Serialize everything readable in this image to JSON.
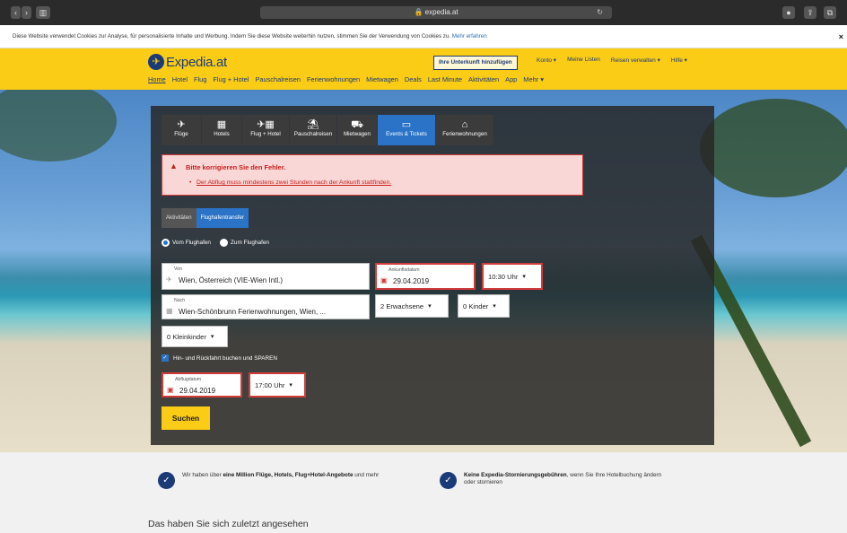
{
  "browser": {
    "url": "expedia.at"
  },
  "cookie": {
    "text": "Diese Website verwendet Cookies zur Analyse, für personalisierte Inhalte und Werbung. Indem Sie diese Website weiterhin nutzen, stimmen Sie der Verwendung von Cookies zu.",
    "link": "Mehr erfahren"
  },
  "header": {
    "brand": "Expedia.at",
    "add_property": "Ihre Unterkunft hinzufügen",
    "account_links": [
      "Konto ▾",
      "Meine Listen",
      "Reisen verwalten ▾",
      "Hilfe ▾"
    ],
    "nav": [
      "Home",
      "Hotel",
      "Flug",
      "Flug + Hotel",
      "Pauschalreisen",
      "Ferienwohnungen",
      "Mietwagen",
      "Deals",
      "Last Minute",
      "Aktivitäten",
      "App",
      "Mehr ▾"
    ]
  },
  "search": {
    "tabs": [
      {
        "label": "Flüge",
        "icon": "plane-icon"
      },
      {
        "label": "Hotels",
        "icon": "hotel-icon"
      },
      {
        "label": "Flug + Hotel",
        "icon": "flight-hotel-icon"
      },
      {
        "label": "Pauschalreisen",
        "icon": "palm-icon"
      },
      {
        "label": "Mietwagen",
        "icon": "car-icon"
      },
      {
        "label": "Events & Tickets",
        "icon": "ticket-icon"
      },
      {
        "label": "Ferienwohnungen",
        "icon": "house-icon"
      }
    ],
    "active_tab": "Events & Tickets",
    "error_title": "Bitte korrigieren Sie den Fehler.",
    "error_message": "Der Abflug muss mindestens zwei Stunden nach der Ankunft stattfinden.",
    "subtabs": [
      "Aktivitäten",
      "Flughafentransfer"
    ],
    "radios": [
      "Vom Flughafen",
      "Zum Flughafen"
    ],
    "from_label": "Von",
    "from_value": "Wien, Österreich (VIE-Wien Intl.)",
    "arrival_label": "Ankunftsdatum",
    "arrival_value": "29.04.2019",
    "arrival_time": "10:30 Uhr",
    "to_label": "Nach",
    "to_value": "Wien-Schönbrunn Ferienwohnungen, Wien, ...",
    "adults": "2 Erwachsene",
    "children": "0 Kinder",
    "infants": "0 Kleinkinder",
    "roundtrip": "Hin- und Rückfahrt buchen und SPAREN",
    "departure_label": "Abflugdatum",
    "departure_value": "29.04.2019",
    "departure_time": "17:00 Uhr",
    "submit": "Suchen"
  },
  "features": {
    "f1_pre": "Wir haben über ",
    "f1_bold": "eine Million Flüge, Hotels, Flug+Hotel-Angebote",
    "f1_post": " und mehr",
    "f2_bold": "Keine Expedia-Stornierungsgebühren",
    "f2_post": ", wenn Sie Ihre Hotelbuchung ändern oder stornieren"
  },
  "recent_title": "Das haben Sie sich zuletzt angesehen"
}
